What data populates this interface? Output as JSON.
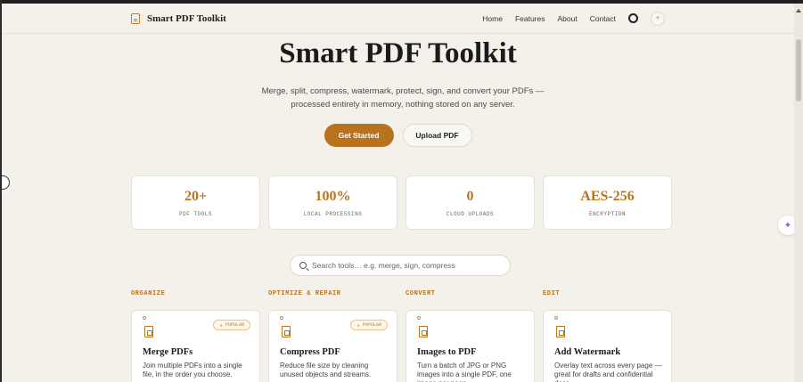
{
  "header": {
    "brand": "Smart PDF Toolkit",
    "nav": [
      "Home",
      "Features",
      "About",
      "Contact"
    ],
    "theme_toggle": "☀"
  },
  "hero": {
    "title": "Smart PDF Toolkit",
    "subtitle_line1": "Merge, split, compress, watermark, protect, sign, and convert your PDFs —",
    "subtitle_line2": "processed entirely in memory, nothing stored on any server.",
    "primary_button": "Get Started",
    "secondary_button": "Upload PDF"
  },
  "stats": [
    {
      "value": "20+",
      "label": "PDF TOOLS"
    },
    {
      "value": "100%",
      "label": "LOCAL PROCESSING"
    },
    {
      "value": "0",
      "label": "CLOUD UPLOADS"
    },
    {
      "value": "AES-256",
      "label": "ENCRYPTION"
    }
  ],
  "search": {
    "placeholder": "Search tools… e.g. merge, sign, compress"
  },
  "categories": [
    "ORGANIZE",
    "OPTIMIZE & REPAIR",
    "CONVERT",
    "EDIT"
  ],
  "tools": [
    {
      "title": "Merge PDFs",
      "desc": "Join multiple PDFs into a single file, in the order you choose.",
      "badge": "POPULAR"
    },
    {
      "title": "Compress PDF",
      "desc": "Reduce file size by cleaning unused objects and streams.",
      "badge": "POPULAR"
    },
    {
      "title": "Images to PDF",
      "desc": "Turn a batch of JPG or PNG images into a single PDF, one image per page.",
      "badge": ""
    },
    {
      "title": "Add Watermark",
      "desc": "Overlay text across every page — great for drafts and confidential docs.",
      "badge": ""
    }
  ],
  "colors": {
    "accent": "#b9731f",
    "background": "#f4f1ea"
  }
}
